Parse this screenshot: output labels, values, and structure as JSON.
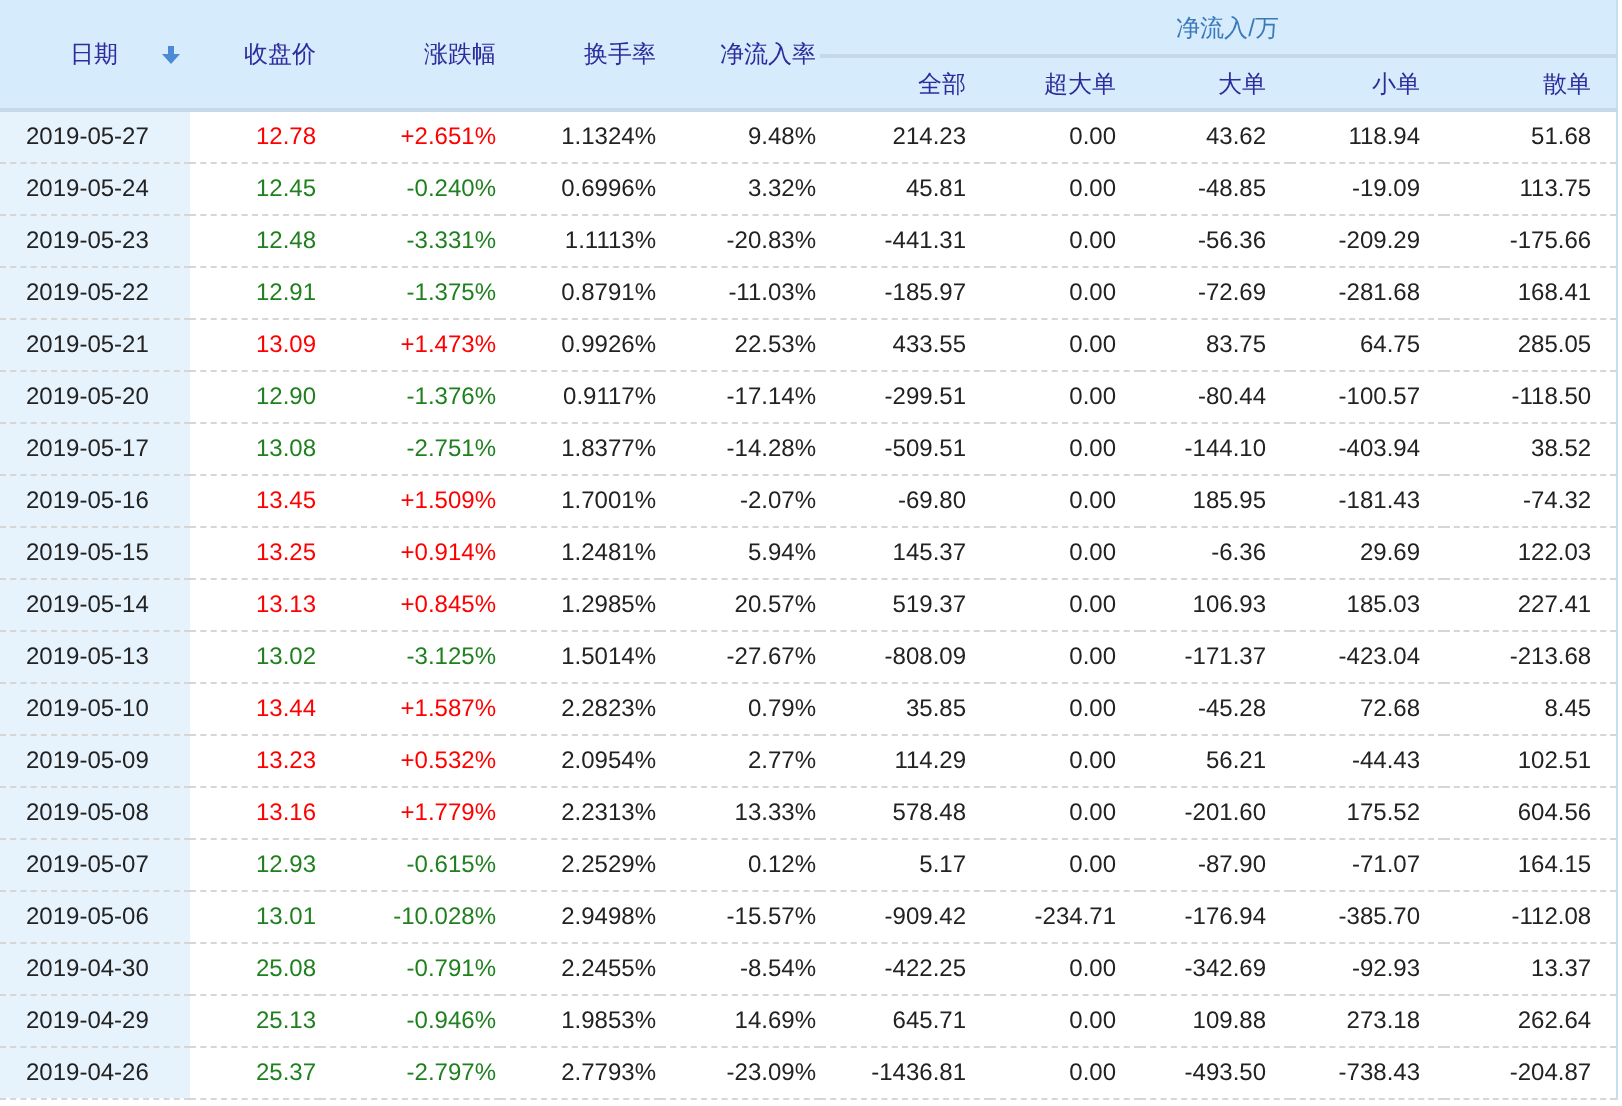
{
  "columns": [
    {
      "label": "日期",
      "sorted": true
    },
    {
      "label": "收盘价",
      "sorted": false
    },
    {
      "label": "涨跌幅",
      "sorted": false
    },
    {
      "label": "换手率",
      "sorted": false
    },
    {
      "label": "净流入率",
      "sorted": false
    }
  ],
  "group_header": "净流入/万",
  "sub_columns": [
    "全部",
    "超大单",
    "大单",
    "小单",
    "散单"
  ],
  "rows": [
    {
      "date": "2019-05-27",
      "close": "12.78",
      "change": "+2.651%",
      "turnover": "1.1324%",
      "rate": "9.48%",
      "flows": [
        "214.23",
        "0.00",
        "43.62",
        "118.94",
        "51.68"
      ],
      "rising": true
    },
    {
      "date": "2019-05-24",
      "close": "12.45",
      "change": "-0.240%",
      "turnover": "0.6996%",
      "rate": "3.32%",
      "flows": [
        "45.81",
        "0.00",
        "-48.85",
        "-19.09",
        "113.75"
      ],
      "rising": false
    },
    {
      "date": "2019-05-23",
      "close": "12.48",
      "change": "-3.331%",
      "turnover": "1.1113%",
      "rate": "-20.83%",
      "flows": [
        "-441.31",
        "0.00",
        "-56.36",
        "-209.29",
        "-175.66"
      ],
      "rising": false
    },
    {
      "date": "2019-05-22",
      "close": "12.91",
      "change": "-1.375%",
      "turnover": "0.8791%",
      "rate": "-11.03%",
      "flows": [
        "-185.97",
        "0.00",
        "-72.69",
        "-281.68",
        "168.41"
      ],
      "rising": false
    },
    {
      "date": "2019-05-21",
      "close": "13.09",
      "change": "+1.473%",
      "turnover": "0.9926%",
      "rate": "22.53%",
      "flows": [
        "433.55",
        "0.00",
        "83.75",
        "64.75",
        "285.05"
      ],
      "rising": true
    },
    {
      "date": "2019-05-20",
      "close": "12.90",
      "change": "-1.376%",
      "turnover": "0.9117%",
      "rate": "-17.14%",
      "flows": [
        "-299.51",
        "0.00",
        "-80.44",
        "-100.57",
        "-118.50"
      ],
      "rising": false
    },
    {
      "date": "2019-05-17",
      "close": "13.08",
      "change": "-2.751%",
      "turnover": "1.8377%",
      "rate": "-14.28%",
      "flows": [
        "-509.51",
        "0.00",
        "-144.10",
        "-403.94",
        "38.52"
      ],
      "rising": false
    },
    {
      "date": "2019-05-16",
      "close": "13.45",
      "change": "+1.509%",
      "turnover": "1.7001%",
      "rate": "-2.07%",
      "flows": [
        "-69.80",
        "0.00",
        "185.95",
        "-181.43",
        "-74.32"
      ],
      "rising": true
    },
    {
      "date": "2019-05-15",
      "close": "13.25",
      "change": "+0.914%",
      "turnover": "1.2481%",
      "rate": "5.94%",
      "flows": [
        "145.37",
        "0.00",
        "-6.36",
        "29.69",
        "122.03"
      ],
      "rising": true
    },
    {
      "date": "2019-05-14",
      "close": "13.13",
      "change": "+0.845%",
      "turnover": "1.2985%",
      "rate": "20.57%",
      "flows": [
        "519.37",
        "0.00",
        "106.93",
        "185.03",
        "227.41"
      ],
      "rising": true
    },
    {
      "date": "2019-05-13",
      "close": "13.02",
      "change": "-3.125%",
      "turnover": "1.5014%",
      "rate": "-27.67%",
      "flows": [
        "-808.09",
        "0.00",
        "-171.37",
        "-423.04",
        "-213.68"
      ],
      "rising": false
    },
    {
      "date": "2019-05-10",
      "close": "13.44",
      "change": "+1.587%",
      "turnover": "2.2823%",
      "rate": "0.79%",
      "flows": [
        "35.85",
        "0.00",
        "-45.28",
        "72.68",
        "8.45"
      ],
      "rising": true
    },
    {
      "date": "2019-05-09",
      "close": "13.23",
      "change": "+0.532%",
      "turnover": "2.0954%",
      "rate": "2.77%",
      "flows": [
        "114.29",
        "0.00",
        "56.21",
        "-44.43",
        "102.51"
      ],
      "rising": true
    },
    {
      "date": "2019-05-08",
      "close": "13.16",
      "change": "+1.779%",
      "turnover": "2.2313%",
      "rate": "13.33%",
      "flows": [
        "578.48",
        "0.00",
        "-201.60",
        "175.52",
        "604.56"
      ],
      "rising": true
    },
    {
      "date": "2019-05-07",
      "close": "12.93",
      "change": "-0.615%",
      "turnover": "2.2529%",
      "rate": "0.12%",
      "flows": [
        "5.17",
        "0.00",
        "-87.90",
        "-71.07",
        "164.15"
      ],
      "rising": false
    },
    {
      "date": "2019-05-06",
      "close": "13.01",
      "change": "-10.028%",
      "turnover": "2.9498%",
      "rate": "-15.57%",
      "flows": [
        "-909.42",
        "-234.71",
        "-176.94",
        "-385.70",
        "-112.08"
      ],
      "rising": false
    },
    {
      "date": "2019-04-30",
      "close": "25.08",
      "change": "-0.791%",
      "turnover": "2.2455%",
      "rate": "-8.54%",
      "flows": [
        "-422.25",
        "0.00",
        "-342.69",
        "-92.93",
        "13.37"
      ],
      "rising": false
    },
    {
      "date": "2019-04-29",
      "close": "25.13",
      "change": "-0.946%",
      "turnover": "1.9853%",
      "rate": "14.69%",
      "flows": [
        "645.71",
        "0.00",
        "109.88",
        "273.18",
        "262.64"
      ],
      "rising": false
    },
    {
      "date": "2019-04-26",
      "close": "25.37",
      "change": "-2.797%",
      "turnover": "2.7793%",
      "rate": "-23.09%",
      "flows": [
        "-1436.81",
        "0.00",
        "-493.50",
        "-738.43",
        "-204.87"
      ],
      "rising": false
    }
  ]
}
